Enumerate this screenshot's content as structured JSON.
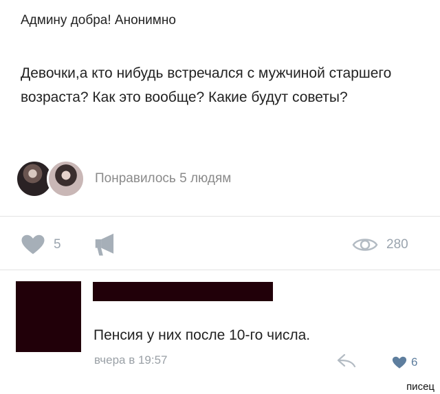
{
  "post": {
    "header": "Админу добра! Анонимно",
    "body": "Девочки,а кто нибудь встречался с мужчиной старшего возраста? Как это вообще? Какие будут советы?",
    "likes_text": "Понравилось 5 людям"
  },
  "actions": {
    "like_count": "5",
    "views_count": "280"
  },
  "comment": {
    "text": "Пенсия у них после 10-го числа.",
    "time": "вчера в 19:57",
    "like_count": "6"
  },
  "watermark": "писец",
  "colors": {
    "accent_like": "#5e7e9e",
    "icon_gray": "#9aa4ae",
    "redaction": "#210009"
  },
  "icons": {
    "like": "heart-icon",
    "share": "megaphone-icon",
    "views": "eye-icon",
    "reply": "reply-arrow-icon"
  }
}
